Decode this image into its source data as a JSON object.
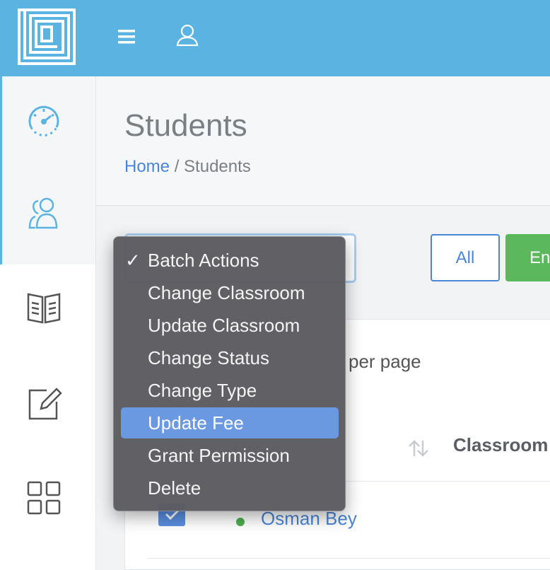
{
  "header": {
    "logo_icon": "maze-logo-icon",
    "menu_icon": "hamburger-icon",
    "user_icon": "user-icon"
  },
  "sidebar": {
    "items": [
      {
        "icon": "speedometer-icon"
      },
      {
        "icon": "users-icon"
      },
      {
        "icon": "book-icon"
      },
      {
        "icon": "edit-icon"
      },
      {
        "icon": "grid-icon"
      }
    ]
  },
  "page": {
    "title": "Students",
    "breadcrumb": {
      "home": "Home",
      "separator": " / ",
      "current": "Students"
    }
  },
  "toolbar": {
    "filter_all": "All",
    "filter_green": "En"
  },
  "table": {
    "per_page_text": "per page",
    "column_classroom": "Classroom",
    "rows": [
      {
        "name": "Osman Bey",
        "status_color": "#4cae4c",
        "checked": true
      }
    ]
  },
  "batch_menu": {
    "items": [
      {
        "label": "Batch Actions",
        "check": "✓"
      },
      {
        "label": "Change Classroom",
        "check": ""
      },
      {
        "label": "Update Classroom",
        "check": ""
      },
      {
        "label": "Change Status",
        "check": ""
      },
      {
        "label": "Change Type",
        "check": ""
      },
      {
        "label": "Update Fee",
        "check": ""
      },
      {
        "label": "Grant Permission",
        "check": ""
      },
      {
        "label": "Delete",
        "check": ""
      }
    ],
    "selected": "Batch Actions",
    "highlighted": "Update Fee"
  },
  "colors": {
    "topbar": "#5ab3e0",
    "accent_blue": "#4a86d8",
    "success_green": "#5cb85c",
    "menu_highlight": "#6a99e1"
  }
}
